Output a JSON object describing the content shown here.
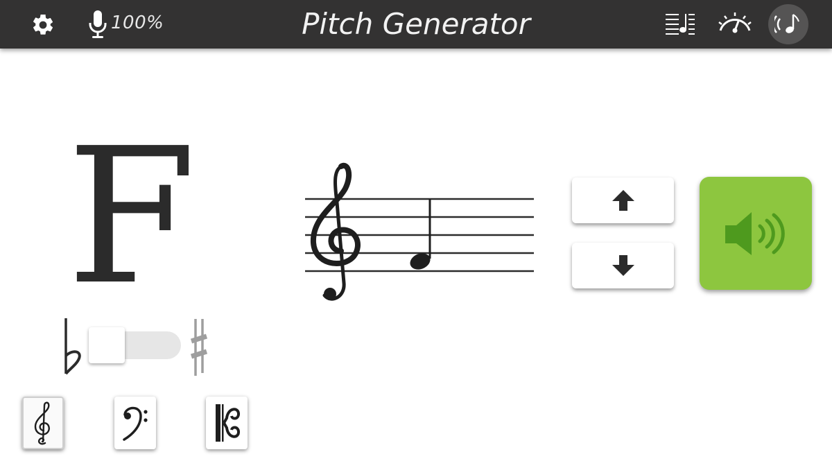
{
  "header": {
    "title": "Pitch Generator",
    "mic_level": "100%",
    "icons": {
      "settings": "gear-icon",
      "microphone": "microphone-icon",
      "staff_view": "staff-lines-icon",
      "tuner": "tuner-gauge-icon",
      "pitch_generator": "sound-note-icon"
    }
  },
  "note": {
    "name": "F",
    "accidental_flat": "♭",
    "accidental_sharp": "♯",
    "accidental_state": "natural"
  },
  "clefs": {
    "options": [
      "treble",
      "bass",
      "alto"
    ],
    "selected": "treble"
  },
  "staff": {
    "clef": "treble",
    "note": "F4",
    "note_value": "quarter"
  },
  "controls": {
    "up_icon": "arrow-up-icon",
    "down_icon": "arrow-down-icon",
    "play_icon": "speaker-icon"
  },
  "colors": {
    "header_bg": "#333232",
    "play_button": "#8dc63f",
    "play_icon": "#4e9a1e",
    "text_dark": "#2b2b2b"
  }
}
